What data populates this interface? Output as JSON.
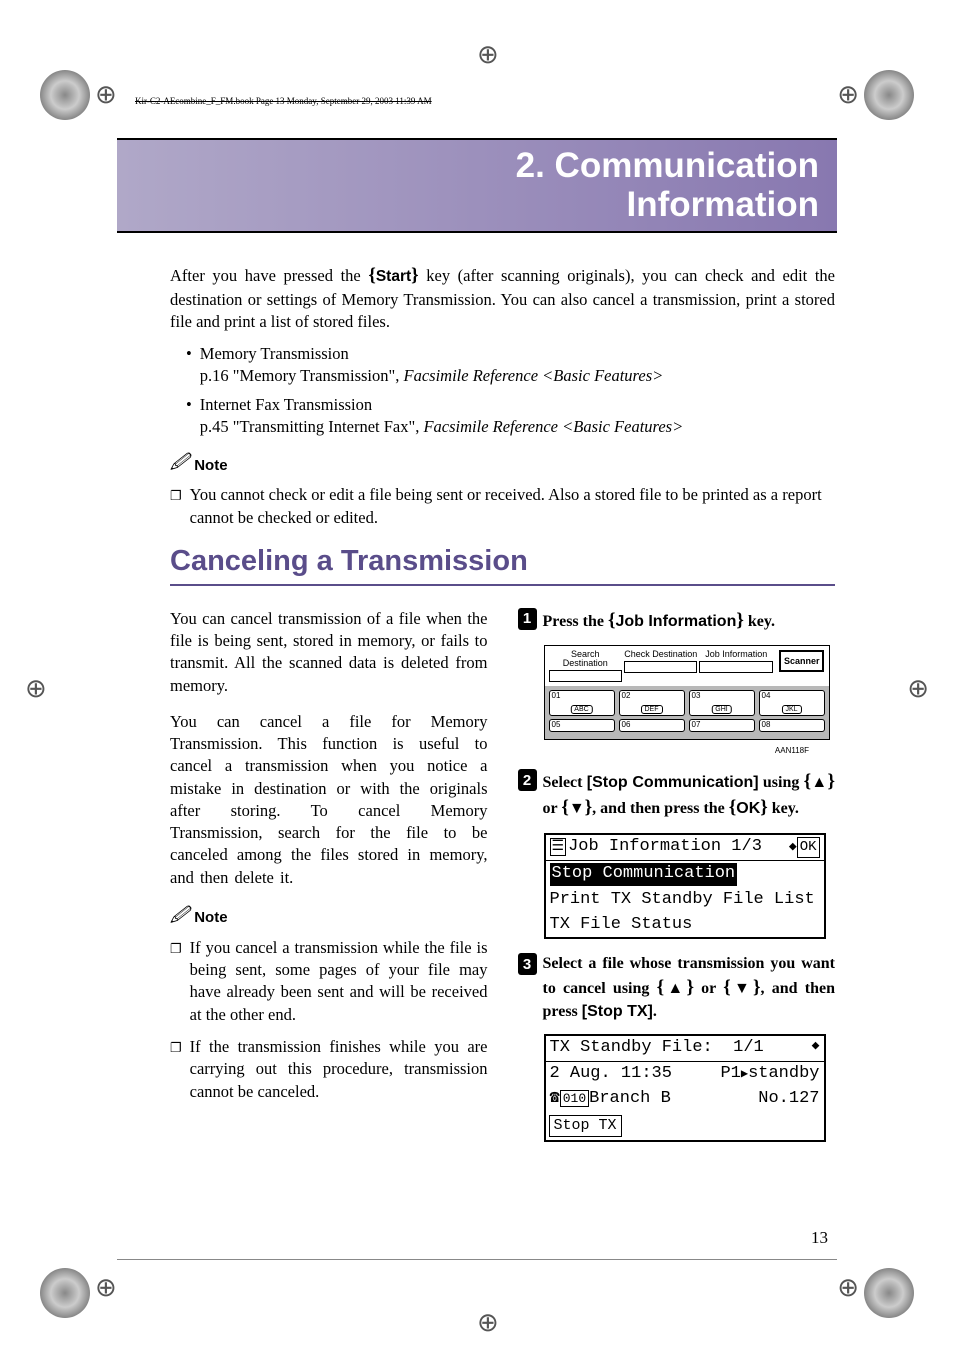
{
  "running_header": "Kir-C2-AEcombine_F_FM.book  Page 13  Monday, September 29, 2003  11:39 AM",
  "chapter_title": "2. Communication Information",
  "intro_1": "After you have pressed the ",
  "intro_key": "Start",
  "intro_2": " key (after scanning originals), you can check and edit the destination or settings of Memory Transmission. You can also cancel a transmission, print a stored file and print a list of stored files.",
  "bullets": [
    {
      "title": "Memory Transmission",
      "ref": "p.16 \"Memory Transmission\", ",
      "italic": "Facsimile Reference <Basic Features>"
    },
    {
      "title": "Internet Fax Transmission",
      "ref": "p.45 \"Transmitting Internet Fax\", ",
      "italic": "Facsimile Reference <Basic Features>"
    }
  ],
  "note_label": "Note",
  "main_note": "You cannot check or edit a file being sent or received. Also a stored file to be printed as a report cannot be checked or edited.",
  "section_heading": "Canceling a Transmission",
  "left_para_1": "You can cancel transmission of a file when the file is being sent, stored in memory, or fails to transmit. All the scanned data is deleted from memory.",
  "left_para_2": "You can cancel a file for Memory Transmission. This function is useful to cancel a transmission when you notice a mistake in destination or with the originals after storing. To cancel Memory Transmission, search for the file to be canceled among the files stored in memory, and then delete it.",
  "left_notes": [
    "If you cancel a transmission while the file is being sent, some pages of your file may have already been sent and will be received at the other end.",
    "If the transmission finishes while you are carrying out this procedure, transmission cannot be canceled."
  ],
  "step1": {
    "pre": "Press the ",
    "key": "Job Information",
    "post": " key."
  },
  "diagram_labels": {
    "search": "Search Destination",
    "check": "Check Destination",
    "job": "Job Information",
    "scanner": "Scanner",
    "keys_top": [
      {
        "num": "01",
        "abc": "ABC"
      },
      {
        "num": "02",
        "abc": "DEF"
      },
      {
        "num": "03",
        "abc": "GHI"
      },
      {
        "num": "04",
        "abc": "JKL"
      }
    ],
    "keys_bottom": [
      "05",
      "06",
      "07",
      "08"
    ],
    "code": "AAN118F"
  },
  "step2": {
    "pre": "Select ",
    "key1": "[Stop Communication]",
    "mid": " using ",
    "post": ", and then press the ",
    "ok": "OK",
    "end": " key."
  },
  "lcd1": {
    "header": "Job Information 1/3",
    "ok": "OK",
    "line1": "Stop Communication",
    "line2": "Print TX Standby File List",
    "line3": "TX File Status"
  },
  "step3": {
    "pre": "Select a file whose transmission you want to cancel using ",
    "post": ", and then press ",
    "stoptx": "[Stop TX]",
    "end": "."
  },
  "lcd2": {
    "header": "TX Standby File:",
    "page": "1/1",
    "date": "2 Aug. 11:35",
    "status": "P1",
    "status2": "standby",
    "dest_num": "010",
    "dest": "Branch B",
    "no": "No.127",
    "button": "Stop TX"
  },
  "page_num": "13"
}
